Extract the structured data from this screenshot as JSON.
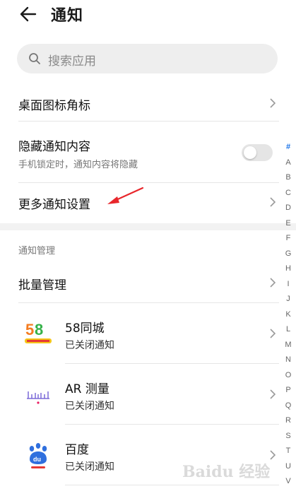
{
  "header": {
    "title": "通知"
  },
  "search": {
    "placeholder": "搜索应用"
  },
  "settings": {
    "badge_label": "桌面图标角标",
    "hide_content_label": "隐藏通知内容",
    "hide_content_sub": "手机锁定时，通知内容将隐藏",
    "hide_content_enabled": false,
    "more_label": "更多通知设置"
  },
  "management": {
    "section_title": "通知管理",
    "batch_label": "批量管理"
  },
  "apps": [
    {
      "name": "58同城",
      "status": "已关闭通知",
      "icon": "58-app-icon"
    },
    {
      "name": "AR 测量",
      "status": "已关闭通知",
      "icon": "ruler-icon"
    },
    {
      "name": "百度",
      "status": "已关闭通知",
      "icon": "baidu-paw-icon"
    }
  ],
  "index_bar": [
    "#",
    "A",
    "B",
    "C",
    "D",
    "E",
    "F",
    "G",
    "H",
    "I",
    "J",
    "K",
    "L",
    "M",
    "N",
    "O",
    "P",
    "Q",
    "R",
    "S",
    "T",
    "U",
    "V"
  ],
  "index_active": "#",
  "colors": {
    "accent": "#1a73e8",
    "annotation": "#e8262b"
  },
  "watermark": "Baidu 经验"
}
